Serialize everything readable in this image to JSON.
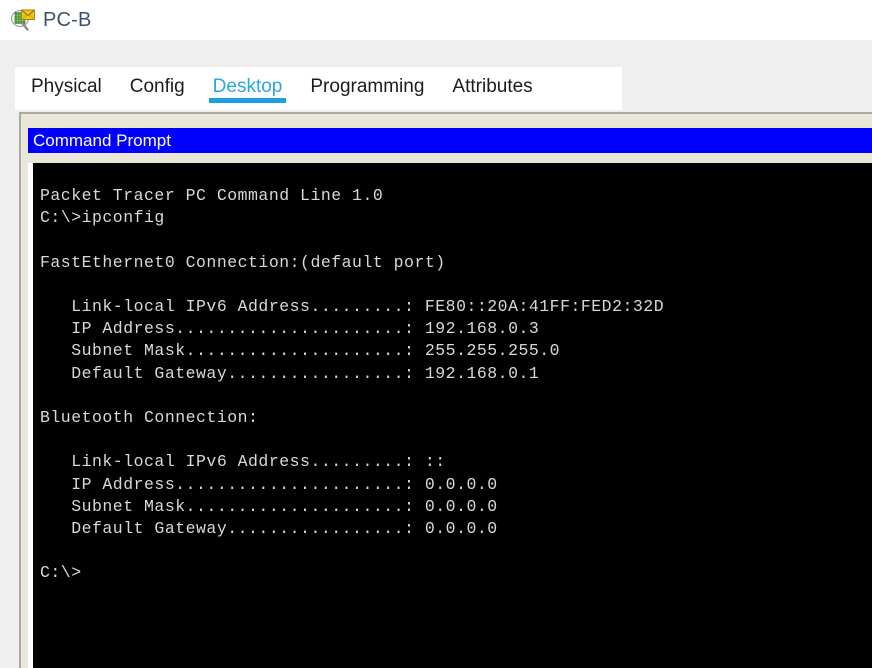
{
  "window": {
    "title": "PC-B",
    "icon": "packet-tracer-pc-icon"
  },
  "tabs": [
    {
      "label": "Physical",
      "active": false
    },
    {
      "label": "Config",
      "active": false
    },
    {
      "label": "Desktop",
      "active": true
    },
    {
      "label": "Programming",
      "active": false
    },
    {
      "label": "Attributes",
      "active": false
    }
  ],
  "command_prompt": {
    "title": "Command Prompt",
    "title_bar_color": "#0000ff",
    "background_color": "#000000",
    "text_color": "#d8d8d8",
    "banner": "Packet Tracer PC Command Line 1.0",
    "prompt": "C:\\>",
    "command": "ipconfig",
    "interfaces": [
      {
        "name": "FastEthernet0 Connection:(default port)",
        "fields": [
          {
            "label": "Link-local IPv6 Address",
            "value": "FE80::20A:41FF:FED2:32D"
          },
          {
            "label": "IP Address",
            "value": "192.168.0.3"
          },
          {
            "label": "Subnet Mask",
            "value": "255.255.255.0"
          },
          {
            "label": "Default Gateway",
            "value": "192.168.0.1"
          }
        ]
      },
      {
        "name": "Bluetooth Connection:",
        "fields": [
          {
            "label": "Link-local IPv6 Address",
            "value": "::"
          },
          {
            "label": "IP Address",
            "value": "0.0.0.0"
          },
          {
            "label": "Subnet Mask",
            "value": "0.0.0.0"
          },
          {
            "label": "Default Gateway",
            "value": "0.0.0.0"
          }
        ]
      }
    ],
    "output_text": "Packet Tracer PC Command Line 1.0\nC:\\>ipconfig\n\nFastEthernet0 Connection:(default port)\n\n   Link-local IPv6 Address.........: FE80::20A:41FF:FED2:32D\n   IP Address......................: 192.168.0.3\n   Subnet Mask.....................: 255.255.255.0\n   Default Gateway.................: 192.168.0.1\n\nBluetooth Connection:\n\n   Link-local IPv6 Address.........: ::\n   IP Address......................: 0.0.0.0\n   Subnet Mask.....................: 0.0.0.0\n   Default Gateway.................: 0.0.0.0\n\nC:\\>",
    "final_prompt": "C:\\>"
  },
  "colors": {
    "accent_tab": "#2aa7e0",
    "panel_beige": "#eae7d9",
    "backdrop_gray": "#efefef",
    "title_text": "#3f526b"
  }
}
